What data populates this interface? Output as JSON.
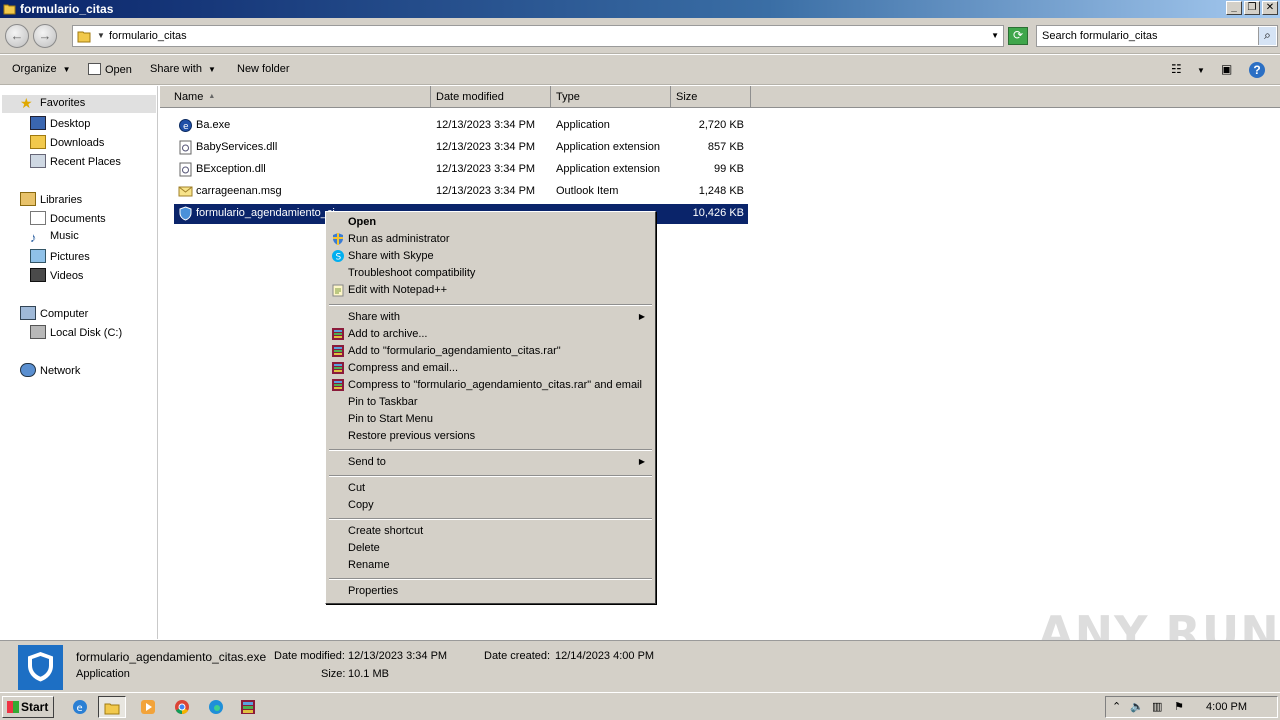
{
  "window": {
    "title": "formulario_citas"
  },
  "address": {
    "path": "formulario_citas"
  },
  "search": {
    "placeholder": "Search formulario_citas"
  },
  "toolbar": {
    "organize": "Organize",
    "open": "Open",
    "share_with": "Share with",
    "new_folder": "New folder"
  },
  "nav": {
    "favorites": "Favorites",
    "desktop": "Desktop",
    "downloads": "Downloads",
    "recent_places": "Recent Places",
    "libraries": "Libraries",
    "documents": "Documents",
    "music": "Music",
    "pictures": "Pictures",
    "videos": "Videos",
    "computer": "Computer",
    "local_disk": "Local Disk (C:)",
    "network": "Network"
  },
  "columns": {
    "name": "Name",
    "date_modified": "Date modified",
    "type": "Type",
    "size": "Size"
  },
  "files": [
    {
      "name": "Ba.exe",
      "date": "12/13/2023 3:34 PM",
      "type": "Application",
      "size": "2,720 KB",
      "icon": "exe-icon"
    },
    {
      "name": "BabyServices.dll",
      "date": "12/13/2023 3:34 PM",
      "type": "Application extension",
      "size": "857 KB",
      "icon": "dll-icon"
    },
    {
      "name": "BException.dll",
      "date": "12/13/2023 3:34 PM",
      "type": "Application extension",
      "size": "99 KB",
      "icon": "dll-icon"
    },
    {
      "name": "carrageenan.msg",
      "date": "12/13/2023 3:34 PM",
      "type": "Outlook Item",
      "size": "1,248 KB",
      "icon": "msg-icon"
    },
    {
      "name": "formulario_agendamiento_ci",
      "date": "",
      "type": "",
      "size": "10,426 KB",
      "icon": "shield-icon"
    }
  ],
  "context_menu": {
    "open": "Open",
    "run_as_admin": "Run as administrator",
    "share_skype": "Share with Skype",
    "troubleshoot": "Troubleshoot compatibility",
    "notepadpp": "Edit with Notepad++",
    "share_with": "Share with",
    "add_archive": "Add to archive...",
    "add_rar": "Add to \"formulario_agendamiento_citas.rar\"",
    "compress_email": "Compress and email...",
    "compress_rar_email": "Compress to \"formulario_agendamiento_citas.rar\" and email",
    "pin_taskbar": "Pin to Taskbar",
    "pin_start": "Pin to Start Menu",
    "restore": "Restore previous versions",
    "send_to": "Send to",
    "cut": "Cut",
    "copy": "Copy",
    "create_shortcut": "Create shortcut",
    "delete": "Delete",
    "rename": "Rename",
    "properties": "Properties"
  },
  "details": {
    "filename": "formulario_agendamiento_citas.exe",
    "type": "Application",
    "date_modified_label": "Date modified:",
    "date_modified": "12/13/2023 3:34 PM",
    "date_created_label": "Date created:",
    "date_created": "12/14/2023 4:00 PM",
    "size_label": "Size:",
    "size": "10.1 MB"
  },
  "watermark": "ANY RUN",
  "taskbar": {
    "start": "Start",
    "clock": "4:00 PM"
  },
  "colors": {
    "selection": "#0a246a",
    "chrome": "#d4d0c8"
  }
}
